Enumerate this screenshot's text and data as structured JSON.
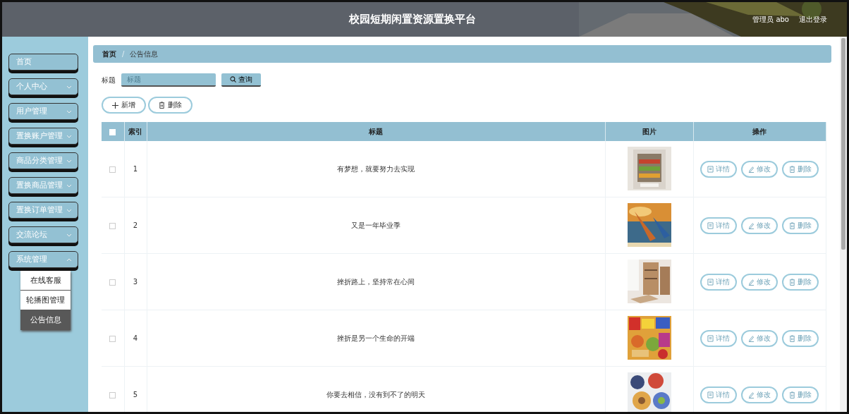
{
  "header": {
    "title": "校园短期闲置资源置换平台",
    "user": "管理员 abo",
    "logout": "退出登录"
  },
  "sidebar": {
    "items": [
      {
        "label": "首页"
      },
      {
        "label": "个人中心",
        "expanded": false
      },
      {
        "label": "用户管理",
        "expanded": false
      },
      {
        "label": "置换账户管理",
        "expanded": false
      },
      {
        "label": "商品分类管理",
        "expanded": false
      },
      {
        "label": "置换商品管理",
        "expanded": false
      },
      {
        "label": "置换订单管理",
        "expanded": false
      },
      {
        "label": "交流论坛",
        "expanded": false
      },
      {
        "label": "系统管理",
        "expanded": true,
        "children": [
          {
            "label": "在线客服",
            "selected": false
          },
          {
            "label": "轮播图管理",
            "selected": false
          },
          {
            "label": "公告信息",
            "selected": true
          }
        ]
      }
    ]
  },
  "breadcrumb": {
    "items": [
      "首页",
      "公告信息"
    ],
    "separator": "/"
  },
  "search": {
    "label": "标题",
    "placeholder": "标题",
    "button": "查询"
  },
  "toolbar": [
    {
      "kind": "add",
      "label": "新增"
    },
    {
      "kind": "delete",
      "label": "删除"
    }
  ],
  "table": {
    "select_all_checked": false,
    "columns": [
      "索引",
      "标题",
      "图片",
      "操作"
    ],
    "rows": [
      {
        "checked": false,
        "index": "1",
        "title": "有梦想，就要努力去实现",
        "picture": {
          "kind": "picture"
        },
        "actions": [
          {
            "kind": "detail",
            "label": "详情"
          },
          {
            "kind": "edit",
            "label": "修改"
          },
          {
            "kind": "delete",
            "label": "删除"
          }
        ]
      },
      {
        "checked": false,
        "index": "2",
        "title": "又是一年毕业季",
        "picture": {
          "kind": "picture"
        },
        "actions": [
          {
            "kind": "detail",
            "label": "详情"
          },
          {
            "kind": "edit",
            "label": "修改"
          },
          {
            "kind": "delete",
            "label": "删除"
          }
        ]
      },
      {
        "checked": false,
        "index": "3",
        "title": "挫折路上，坚持常在心间",
        "picture": {
          "kind": "picture"
        },
        "actions": [
          {
            "kind": "detail",
            "label": "详情"
          },
          {
            "kind": "edit",
            "label": "修改"
          },
          {
            "kind": "delete",
            "label": "删除"
          }
        ]
      },
      {
        "checked": false,
        "index": "4",
        "title": "挫折是另一个生命的开端",
        "picture": {
          "kind": "picture"
        },
        "actions": [
          {
            "kind": "detail",
            "label": "详情"
          },
          {
            "kind": "edit",
            "label": "修改"
          },
          {
            "kind": "delete",
            "label": "删除"
          }
        ]
      },
      {
        "checked": false,
        "index": "5",
        "title": "你要去相信，没有到不了的明天",
        "picture": {
          "kind": "picture"
        },
        "actions": [
          {
            "kind": "detail",
            "label": "详情"
          },
          {
            "kind": "edit",
            "label": "修改"
          },
          {
            "kind": "delete",
            "label": "删除"
          }
        ]
      }
    ]
  }
}
